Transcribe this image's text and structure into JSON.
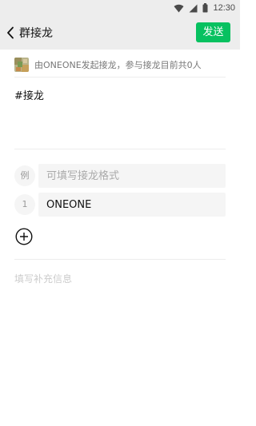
{
  "status_bar": {
    "time": "12:30",
    "icons": [
      "wifi-icon",
      "signal-icon",
      "battery-icon"
    ]
  },
  "nav": {
    "title": "群接龙",
    "send_label": "发送"
  },
  "info": {
    "text": "由ONEONE发起接龙，参与接龙目前共0人"
  },
  "topic": "#接龙",
  "entries": [
    {
      "number": "例",
      "placeholder": "可填写接龙格式",
      "value": ""
    },
    {
      "number": "1",
      "placeholder": "",
      "value": "ONEONE"
    }
  ],
  "supplement": {
    "placeholder": "填写补充信息"
  },
  "colors": {
    "accent": "#07c160",
    "bar_bg": "#ededed",
    "input_bg": "#f5f5f5"
  }
}
